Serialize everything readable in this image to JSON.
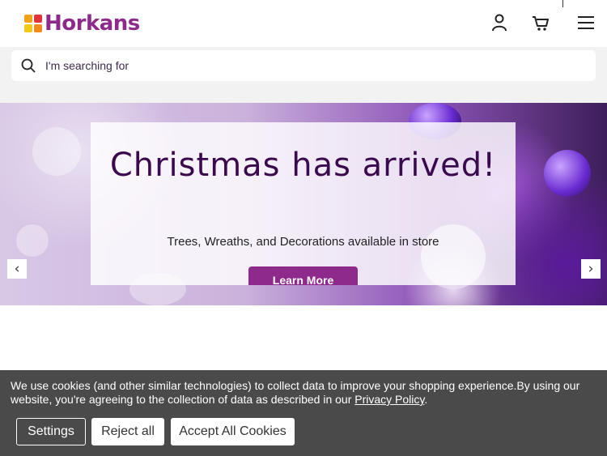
{
  "header": {
    "brand": "Horkans",
    "account_icon": "user-icon",
    "cart_icon": "cart-icon",
    "menu_icon": "hamburger-menu-icon"
  },
  "search": {
    "placeholder": "I'm searching for",
    "icon": "search-icon"
  },
  "banner": {
    "title": "Christmas has arrived!",
    "subtitle": "Trees, Wreaths, and Decorations available in store",
    "cta_label": "Learn More",
    "prev_label": "‹",
    "next_label": "›"
  },
  "cookie_banner": {
    "text_before_link": "We use cookies (and other similar technologies) to collect data to improve your shopping experience.By using our website, you're agreeing to the collection of data as described in our ",
    "link_text": "Privacy Policy",
    "text_after_link": ".",
    "settings_label": "Settings",
    "reject_label": "Reject all",
    "accept_label": "Accept All Cookies"
  },
  "colors": {
    "brand_purple": "#8e2a8b",
    "title_purple": "#3b0a4e",
    "cookie_bg": "#4a4a4a"
  }
}
